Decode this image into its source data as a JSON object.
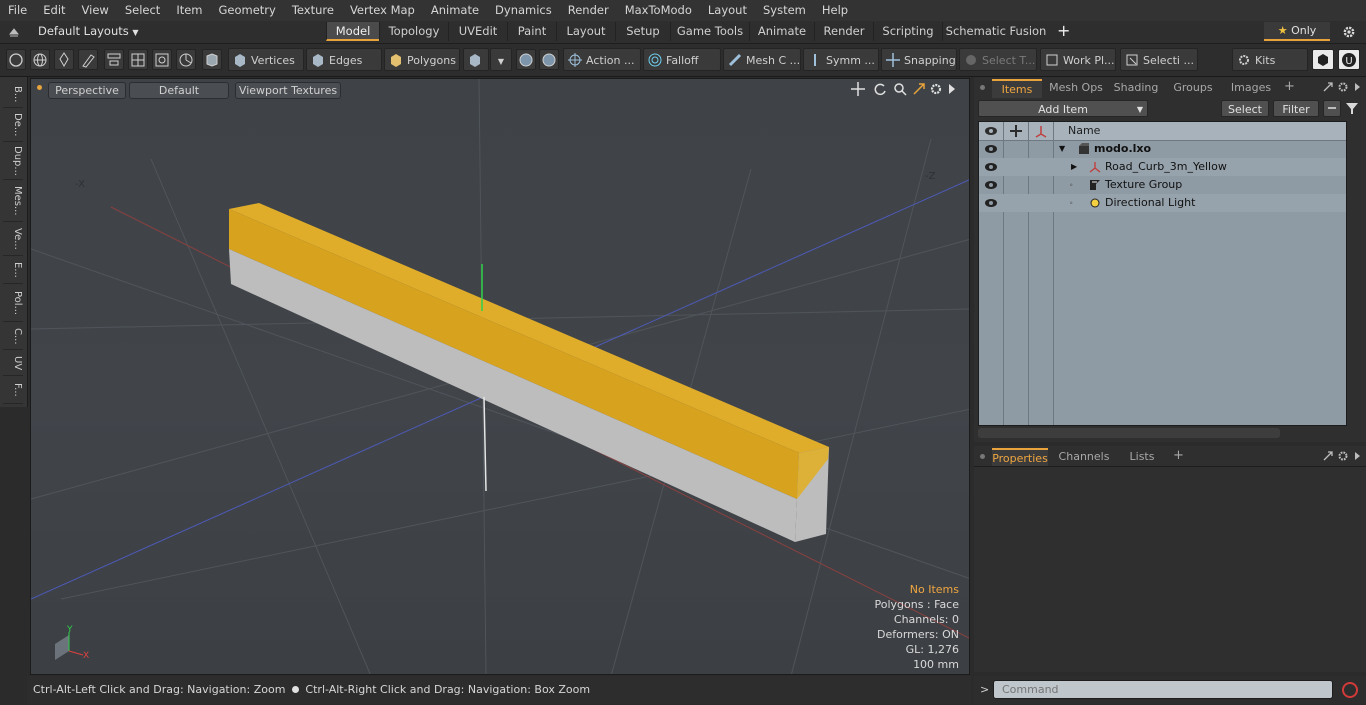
{
  "menu": [
    "File",
    "Edit",
    "View",
    "Select",
    "Item",
    "Geometry",
    "Texture",
    "Vertex Map",
    "Animate",
    "Dynamics",
    "Render",
    "MaxToModo",
    "Layout",
    "System",
    "Help"
  ],
  "layouts": {
    "selector": "Default Layouts",
    "tabs": [
      "Model",
      "Topology",
      "UVEdit",
      "Paint",
      "Layout",
      "Setup",
      "Game Tools",
      "Animate",
      "Render",
      "Scripting",
      "Schematic Fusion"
    ],
    "active": "Model",
    "add": "+",
    "only_label": "Only"
  },
  "toolbar": {
    "vertices": "Vertices",
    "edges": "Edges",
    "polygons": "Polygons",
    "action": "Action ...",
    "falloff": "Falloff",
    "mesh": "Mesh C ...",
    "symm": "Symm ...",
    "snapping": "Snapping",
    "select_t": "Select T...",
    "work_pl": "Work Pl...",
    "selecti": "Selecti ...",
    "kits": "Kits"
  },
  "left_tabs": [
    "B...",
    "De...",
    "Dup...",
    "Mes...",
    "Ve...",
    "E...",
    "Pol...",
    "C...",
    "UV",
    "F..."
  ],
  "viewport": {
    "view": "Perspective",
    "shading": "Default",
    "textures": "Viewport Textures",
    "axis_neg_x": "-X",
    "axis_neg_z": "-Z",
    "gizmo_y": "Y",
    "gizmo_x": "X",
    "stats": {
      "selection": "No Items",
      "polygons": "Polygons : Face",
      "channels": "Channels: 0",
      "deformers": "Deformers: ON",
      "gl": "GL: 1,276",
      "unit": "100 mm"
    }
  },
  "status": {
    "hint1": "Ctrl-Alt-Left Click and Drag: Navigation: Zoom",
    "hint2": "Ctrl-Alt-Right Click and Drag: Navigation: Box Zoom"
  },
  "items_panel": {
    "tabs": [
      "Items",
      "Mesh Ops",
      "Shading",
      "Groups",
      "Images"
    ],
    "active": "Items",
    "add_item": "Add Item",
    "select": "Select",
    "filter": "Filter",
    "name_header": "Name",
    "tree": [
      {
        "label": "modo.lxo",
        "bold": true
      },
      {
        "label": "Road_Curb_3m_Yellow",
        "bold": false
      },
      {
        "label": "Texture Group",
        "bold": false
      },
      {
        "label": "Directional Light",
        "bold": false
      }
    ]
  },
  "props_panel": {
    "tabs": [
      "Properties",
      "Channels",
      "Lists"
    ],
    "active": "Properties"
  },
  "command": {
    "placeholder": "Command",
    "prompt": ">"
  },
  "colors": {
    "accent": "#e8a33c",
    "curb_yellow": "#d9a521",
    "curb_concrete": "#b9b9b9",
    "tree_bg": "#8e9aa4"
  }
}
